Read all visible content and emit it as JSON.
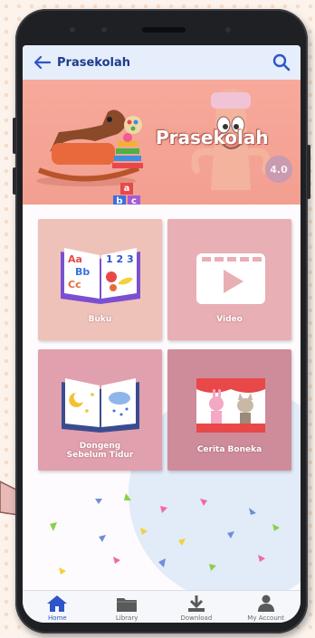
{
  "appbar": {
    "title": "Prasekolah"
  },
  "banner": {
    "logo_text": "Prasekolah",
    "version": "4.0",
    "blocks": [
      "a",
      "b",
      "c"
    ]
  },
  "tiles": [
    {
      "label": "Buku",
      "icon": "book-icon",
      "color": "#efc2b9"
    },
    {
      "label": "Video",
      "icon": "video-icon",
      "color": "#e8afb5"
    },
    {
      "label": "Dongeng\nSebelum Tidur",
      "label_line1": "Dongeng",
      "label_line2": "Sebelum Tidur",
      "icon": "bedtime-book-icon",
      "color": "#e0a0ad"
    },
    {
      "label": "Cerita Boneka",
      "icon": "puppet-theater-icon",
      "color": "#ce8c9b"
    }
  ],
  "book_glyphs": {
    "aa": "Aa",
    "bb": "Bb",
    "cc": "Cc",
    "nums": "1 2 3"
  },
  "nav": [
    {
      "label": "Home",
      "icon": "home-icon",
      "active": true
    },
    {
      "label": "Library",
      "icon": "folder-icon",
      "active": false
    },
    {
      "label": "Download",
      "icon": "download-icon",
      "active": false
    },
    {
      "label": "My Account",
      "icon": "account-icon",
      "active": false
    }
  ],
  "colors": {
    "accent": "#2f56c8",
    "banner": "#f29f91",
    "title": "#1d3c8f"
  }
}
